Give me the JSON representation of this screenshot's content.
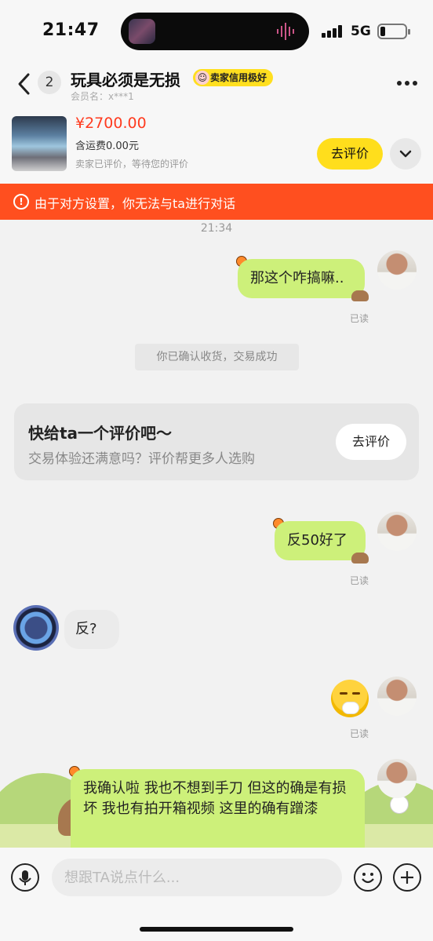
{
  "status_bar": {
    "time": "21:47",
    "network": "5G"
  },
  "header": {
    "badge_count": "2",
    "title": "玩具必须是无损",
    "credit_badge": "卖家信用极好",
    "member_name": "会员名：x***1"
  },
  "product": {
    "price": "¥2700.00",
    "shipping": "含运费0.00元",
    "status": "卖家已评价，等待您的评价",
    "review_button": "去评价"
  },
  "warning": {
    "icon": "!",
    "text": "由于对方设置，你无法与ta进行对话"
  },
  "messages": {
    "timestamp": "21:34",
    "msg1": {
      "text": "那这个咋搞嘛..",
      "read": "已读"
    },
    "system": "你已确认收货，交易成功",
    "review_card": {
      "title": "快给ta一个评价吧～",
      "subtitle": "交易体验还满意吗？评价帮更多人选购",
      "button": "去评价"
    },
    "msg2": {
      "text": "反50好了",
      "read": "已读"
    },
    "msg3": {
      "text": "反?"
    },
    "msg4": {
      "read": "已读"
    },
    "msg5": {
      "text": "我确认啦 我也不想到手刀 但这的确是有损坏 我也有拍开箱视频 这里的确有蹭漆"
    }
  },
  "input": {
    "placeholder": "想跟TA说点什么..."
  },
  "icons": {
    "back": "chevron-left-icon",
    "more": "more-dots-icon",
    "expand": "chevron-down-icon",
    "warning": "warning-circle-icon",
    "voice": "microphone-icon",
    "emoji": "smiley-icon",
    "plus": "plus-icon"
  },
  "colors": {
    "accent_yellow": "#ffde1c",
    "warning_red": "#ff4f1f",
    "bubble_green": "#cdf07a",
    "price_red": "#ff3b1f"
  }
}
